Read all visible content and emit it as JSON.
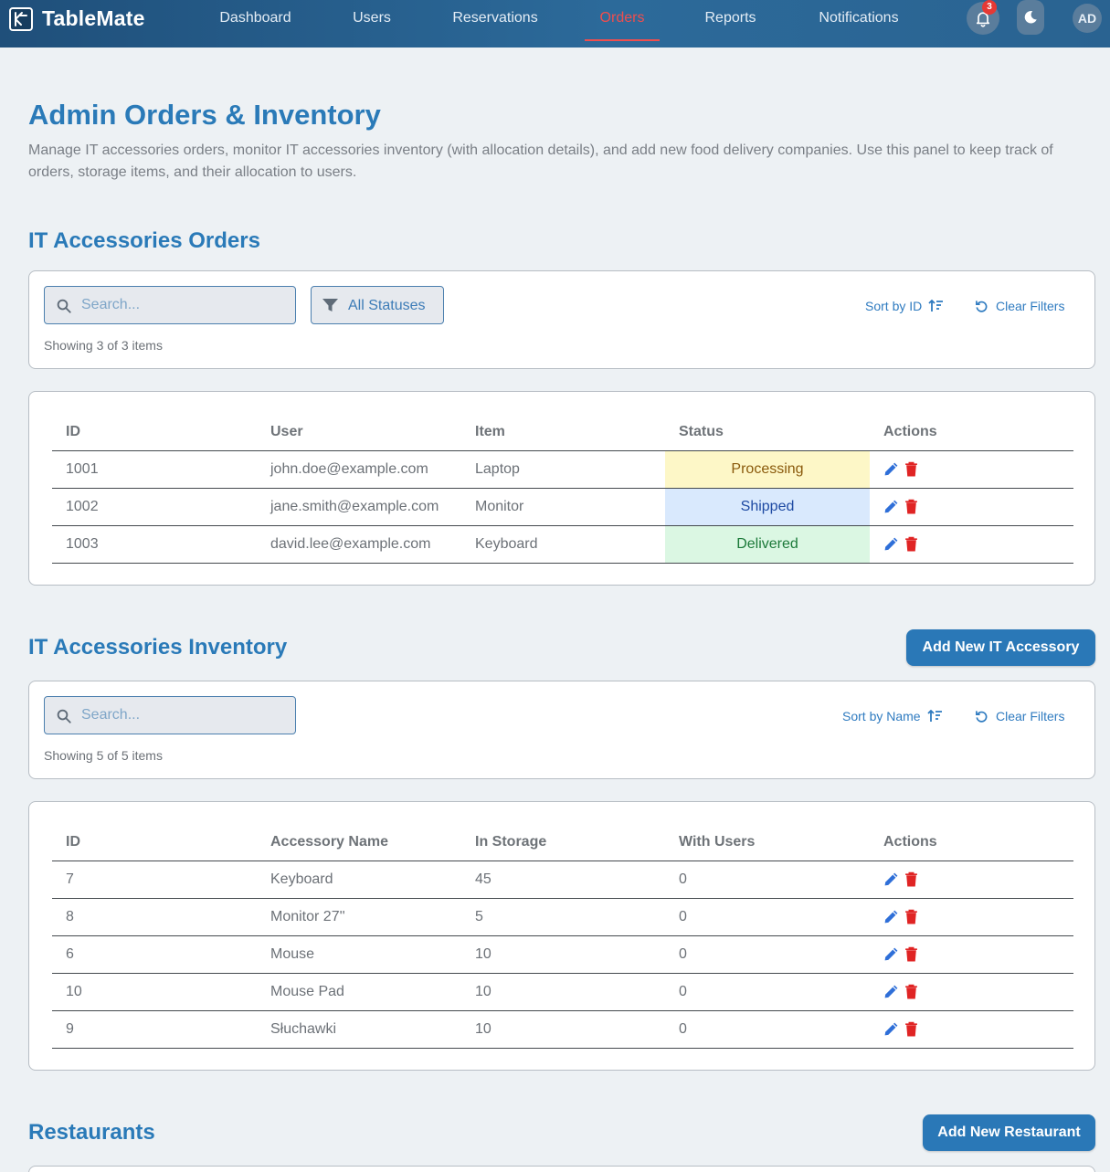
{
  "nav": {
    "brand": "TableMate",
    "links": [
      "Dashboard",
      "Users",
      "Reservations",
      "Orders",
      "Reports",
      "Notifications"
    ],
    "active": "Orders",
    "notification_count": "3",
    "avatar": "AD",
    "accent_color": "#ef4e4e"
  },
  "page": {
    "title": "Admin Orders & Inventory",
    "description": "Manage IT accessories orders, monitor IT accessories inventory (with allocation details), and add new food delivery companies. Use this panel to keep track of orders, storage items, and their allocation to users."
  },
  "orders": {
    "title": "IT Accessories Orders",
    "search_placeholder": "Search...",
    "status_filter": "All Statuses",
    "sort_label": "Sort by ID",
    "clear_label": "Clear Filters",
    "showing": "Showing 3 of 3 items",
    "columns": [
      "ID",
      "User",
      "Item",
      "Status",
      "Actions"
    ],
    "rows": [
      {
        "id": "1001",
        "user": "john.doe@example.com",
        "item": "Laptop",
        "status": "Processing",
        "status_color": "#fdf7c7"
      },
      {
        "id": "1002",
        "user": "jane.smith@example.com",
        "item": "Monitor",
        "status": "Shipped",
        "status_color": "#d9e9fd"
      },
      {
        "id": "1003",
        "user": "david.lee@example.com",
        "item": "Keyboard",
        "status": "Delivered",
        "status_color": "#dbf7e3"
      }
    ]
  },
  "inventory": {
    "title": "IT Accessories Inventory",
    "add_button": "Add New IT Accessory",
    "search_placeholder": "Search...",
    "sort_label": "Sort by Name",
    "clear_label": "Clear Filters",
    "showing": "Showing 5 of 5 items",
    "columns": [
      "ID",
      "Accessory Name",
      "In Storage",
      "With Users",
      "Actions"
    ],
    "rows": [
      {
        "id": "7",
        "name": "Keyboard",
        "in_storage": "45",
        "with_users": "0"
      },
      {
        "id": "8",
        "name": "Monitor 27''",
        "in_storage": "5",
        "with_users": "0"
      },
      {
        "id": "6",
        "name": "Mouse",
        "in_storage": "10",
        "with_users": "0"
      },
      {
        "id": "10",
        "name": "Mouse Pad",
        "in_storage": "10",
        "with_users": "0"
      },
      {
        "id": "9",
        "name": "Słuchawki",
        "in_storage": "10",
        "with_users": "0"
      }
    ]
  },
  "restaurants": {
    "title": "Restaurants",
    "add_button": "Add New Restaurant"
  },
  "icons": {
    "edit": "pencil-icon",
    "delete": "trash-icon",
    "search": "search-icon",
    "filter": "funnel-icon",
    "sort": "sort-ascending-icon",
    "clear": "reset-icon",
    "bell": "bell-icon",
    "theme": "moon-icon"
  },
  "colors": {
    "primary": "#2a78b7",
    "edit_icon": "#2f6fd8",
    "delete_icon": "#e02424"
  }
}
